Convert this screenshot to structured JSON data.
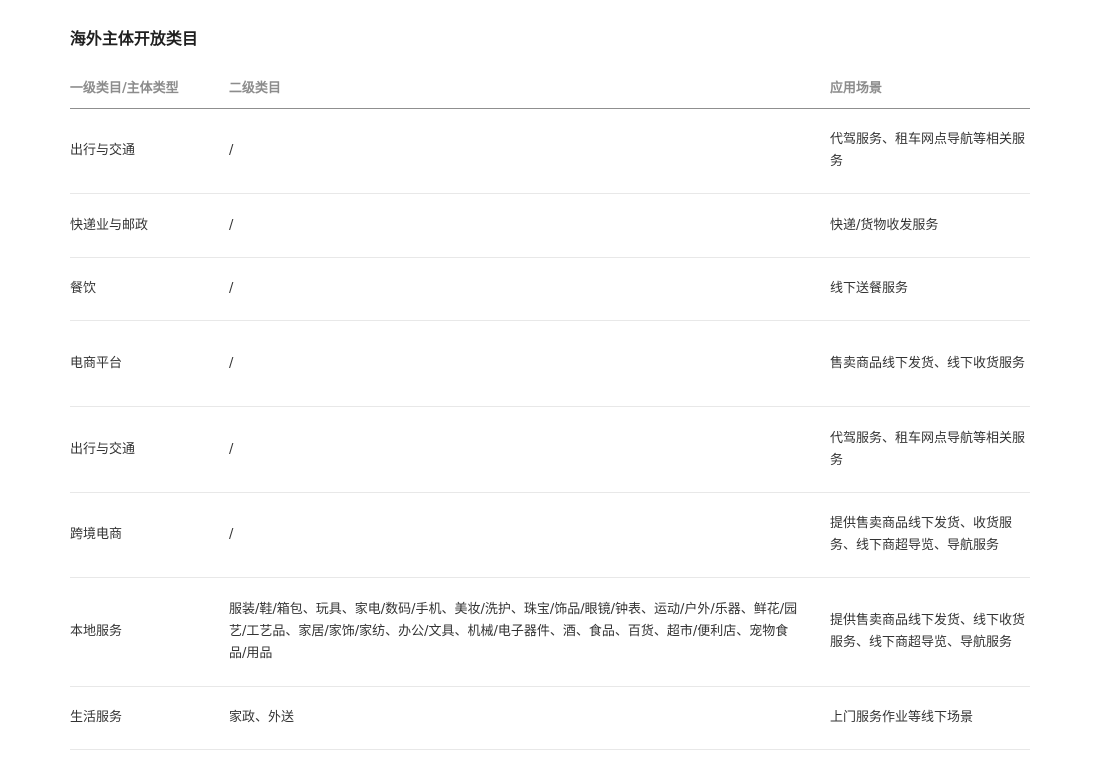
{
  "title": "海外主体开放类目",
  "columns": {
    "level1": "一级类目/主体类型",
    "level2": "二级类目",
    "scenario": "应用场景"
  },
  "rows": [
    {
      "level1": "出行与交通",
      "level2": "/",
      "scenario": "代驾服务、租车网点导航等相关服务"
    },
    {
      "level1": "快递业与邮政",
      "level2": "/",
      "scenario": "快递/货物收发服务"
    },
    {
      "level1": "餐饮",
      "level2": "/",
      "scenario": "线下送餐服务"
    },
    {
      "level1": "电商平台",
      "level2": "/",
      "scenario": "售卖商品线下发货、线下收货服务"
    },
    {
      "level1": "出行与交通",
      "level2": "/",
      "scenario": "代驾服务、租车网点导航等相关服务"
    },
    {
      "level1": "跨境电商",
      "level2": "/",
      "scenario": "提供售卖商品线下发货、收货服务、线下商超导览、导航服务"
    },
    {
      "level1": "本地服务",
      "level2": "服装/鞋/箱包、玩具、家电/数码/手机、美妆/洗护、珠宝/饰品/眼镜/钟表、运动/户外/乐器、鲜花/园艺/工艺品、家居/家饰/家纺、办公/文具、机械/电子器件、酒、食品、百货、超市/便利店、宠物食品/用品",
      "scenario": "提供售卖商品线下发货、线下收货服务、线下商超导览、导航服务"
    },
    {
      "level1": "生活服务",
      "level2": "家政、外送",
      "scenario": "上门服务作业等线下场景"
    }
  ]
}
